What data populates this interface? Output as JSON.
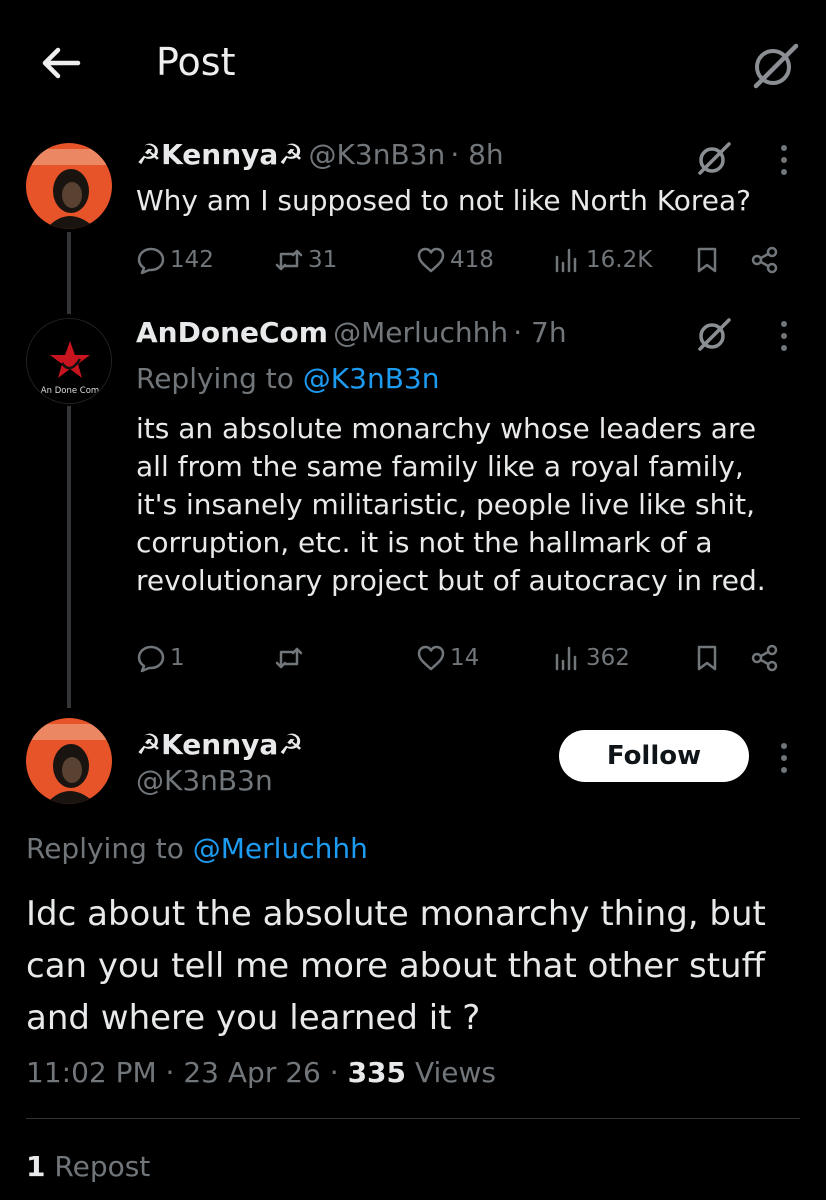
{
  "header": {
    "title": "Post"
  },
  "tweets": [
    {
      "name": "☭Kennya☭",
      "handle": "@K3nB3n",
      "time": "· 8h",
      "text": "Why am I supposed to not like North Korea?",
      "replies": "142",
      "reposts": "31",
      "likes": "418",
      "views": "16.2K"
    },
    {
      "name": "AnDoneCom",
      "handle": "@Merluchhh",
      "time": "· 7h",
      "replying_prefix": "Replying to ",
      "replying_to": "@K3nB3n",
      "avatar_caption": "An Done Com",
      "lines": [
        "its an absolute monarchy whose leaders are",
        "all from the same family like a royal family,",
        "it's insanely militaristic, people live like shit,",
        "corruption, etc. it is not the hallmark of a",
        "revolutionary project but of autocracy in red."
      ],
      "replies": "1",
      "reposts": "",
      "likes": "14",
      "views": "362"
    }
  ],
  "main": {
    "name": "☭Kennya☭",
    "handle": "@K3nB3n",
    "follow_label": "Follow",
    "replying_prefix": "Replying to ",
    "replying_to": "@Merluchhh",
    "lines": [
      "Idc about the absolute monarchy thing, but",
      "can you tell me more about that other stuff",
      "and where you learned it ?"
    ],
    "time": "11:02 PM",
    "date": "23 Apr 26",
    "views_count": "335",
    "views_label": "Views",
    "repost_count": "1",
    "repost_label": "Repost"
  },
  "colors": {
    "accent": "#1d9bf0",
    "muted": "#71767b",
    "text": "#e7e9ea",
    "avatar_red": "#e8542a"
  }
}
